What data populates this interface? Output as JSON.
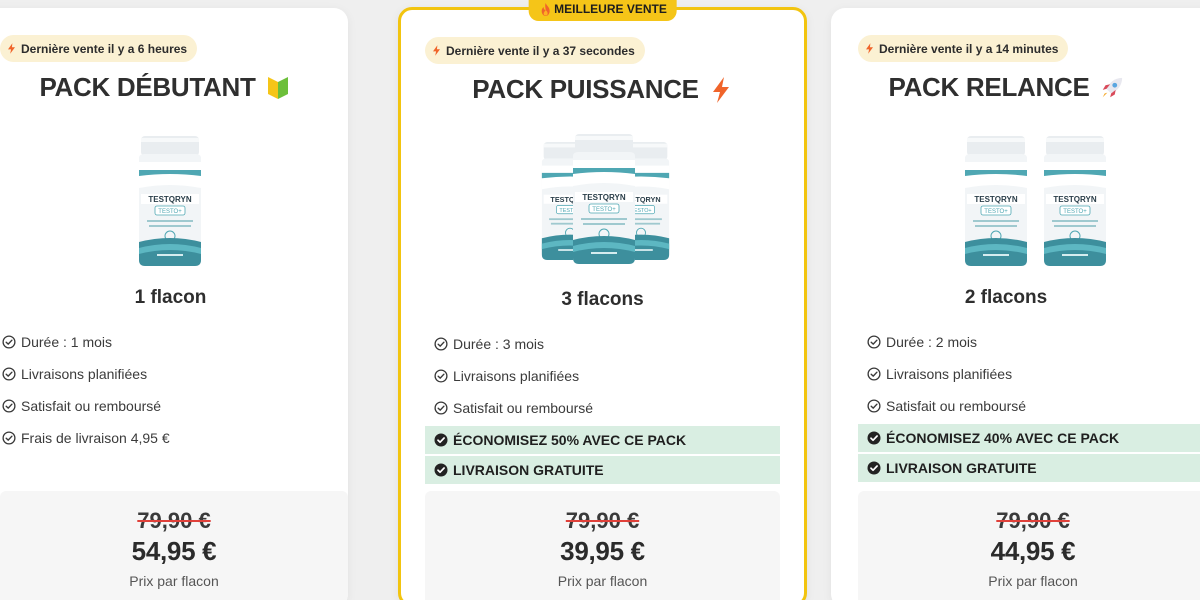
{
  "ribbon": {
    "label": "MEILLEURE VENTE"
  },
  "colors": {
    "accent": "#f5c518",
    "highlight_bg": "#d9eee2",
    "strike": "#e0413a",
    "badge_bg": "#fbf1d3"
  },
  "packs": [
    {
      "last_sale": "Dernière vente il y a 6 heures",
      "title": "PACK DÉBUTANT",
      "emoji_icon": "beginner-badge-icon",
      "count": "1 flacon",
      "features": [
        "Durée : 1 mois",
        "Livraisons planifiées",
        "Satisfait ou remboursé",
        "Frais de livraison 4,95 €"
      ],
      "highlights": [],
      "old_price": "79,90 €",
      "new_price": "54,95 €",
      "unit": "Prix par flacon"
    },
    {
      "last_sale": "Dernière vente il y a 37 secondes",
      "title": "PACK PUISSANCE",
      "emoji_icon": "lightning-icon",
      "count": "3 flacons",
      "features": [
        "Durée : 3 mois",
        "Livraisons planifiées",
        "Satisfait ou remboursé"
      ],
      "highlights": [
        "ÉCONOMISEZ 50% AVEC CE PACK",
        "LIVRAISON GRATUITE"
      ],
      "old_price": "79,90 €",
      "new_price": "39,95 €",
      "unit": "Prix par flacon"
    },
    {
      "last_sale": "Dernière vente il y a 14 minutes",
      "title": "PACK RELANCE",
      "emoji_icon": "rocket-icon",
      "count": "2 flacons",
      "features": [
        "Durée : 2 mois",
        "Livraisons planifiées",
        "Satisfait ou remboursé"
      ],
      "highlights": [
        "ÉCONOMISEZ 40% AVEC CE PACK",
        "LIVRAISON GRATUITE"
      ],
      "old_price": "79,90 €",
      "new_price": "44,95 €",
      "unit": "Prix par flacon"
    }
  ],
  "bottle_label": {
    "brand": "TESTQRYN",
    "sub": "TESTO+"
  }
}
